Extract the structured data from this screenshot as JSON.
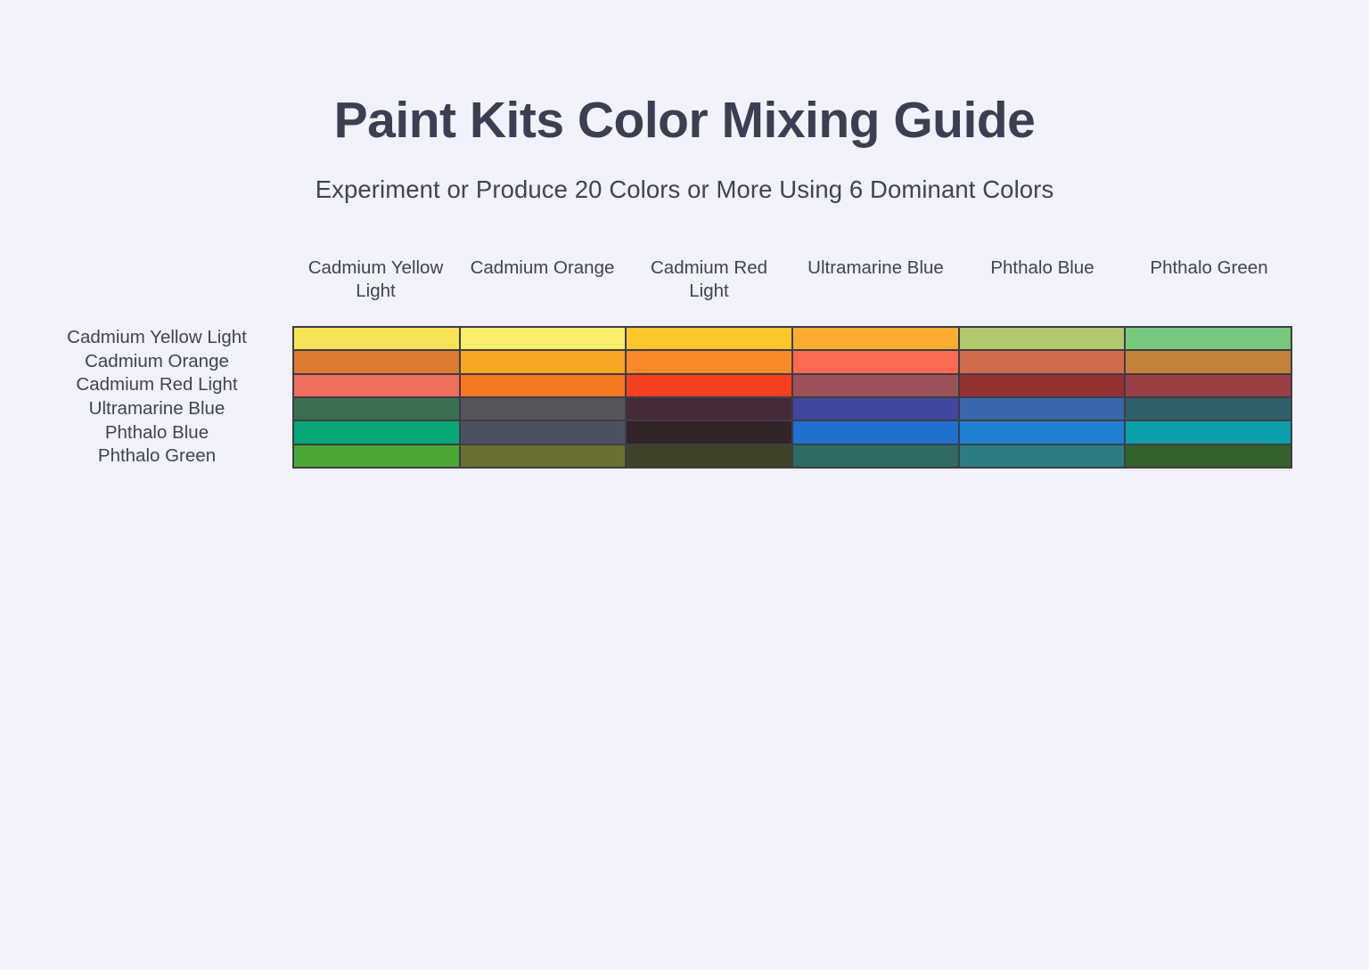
{
  "header": {
    "title": "Paint Kits Color Mixing Guide",
    "subtitle": "Experiment or Produce 20 Colors or More Using 6 Dominant Colors"
  },
  "theme": {
    "background": "#F1F2FB",
    "text": "#3F4356",
    "title_text": "#3B3F51",
    "grid_border": "#3D3D45"
  },
  "chart_data": {
    "type": "heatmap",
    "title": "Paint Kits Color Mixing Guide",
    "subtitle": "Experiment or Produce 20 Colors or More Using 6 Dominant Colors",
    "xlabel": "",
    "ylabel": "",
    "grid": true,
    "legend": "none",
    "columns": [
      "Cadmium Yellow Light",
      "Cadmium Orange",
      "Cadmium Red Light",
      "Ultramarine Blue",
      "Phthalo Blue",
      "Phthalo Green"
    ],
    "rows": [
      "Cadmium Yellow Light",
      "Cadmium Orange",
      "Cadmium Red Light",
      "Ultramarine Blue",
      "Phthalo Blue",
      "Phthalo Green"
    ],
    "cells": [
      {
        "row": "Cadmium Yellow Light",
        "values": [
          "#F8E358",
          "#FAEE6A",
          "#FBC72D",
          "#F9AE32",
          "#AFC96B",
          "#76C97C"
        ]
      },
      {
        "row": "Cadmium Orange",
        "values": [
          "#DD7930",
          "#F6A723",
          "#F88A2A",
          "#FC6A53",
          "#D26B4E",
          "#C3823A"
        ]
      },
      {
        "row": "Cadmium Red Light",
        "values": [
          "#EE6F5E",
          "#F77620",
          "#F4401F",
          "#9B5259",
          "#923232",
          "#994046"
        ]
      },
      {
        "row": "Ultramarine Blue",
        "values": [
          "#3C6E52",
          "#56555B",
          "#452B39",
          "#41479E",
          "#3A66AC",
          "#2F6069"
        ]
      },
      {
        "row": "Phthalo Blue",
        "values": [
          "#08A778",
          "#4C5162",
          "#332428",
          "#2070CD",
          "#1E81D4",
          "#0C9FAC"
        ]
      },
      {
        "row": "Phthalo Green",
        "values": [
          "#4CA835",
          "#6B6F33",
          "#3E4228",
          "#2F6A65",
          "#2C7C83",
          "#33632C"
        ]
      }
    ]
  }
}
